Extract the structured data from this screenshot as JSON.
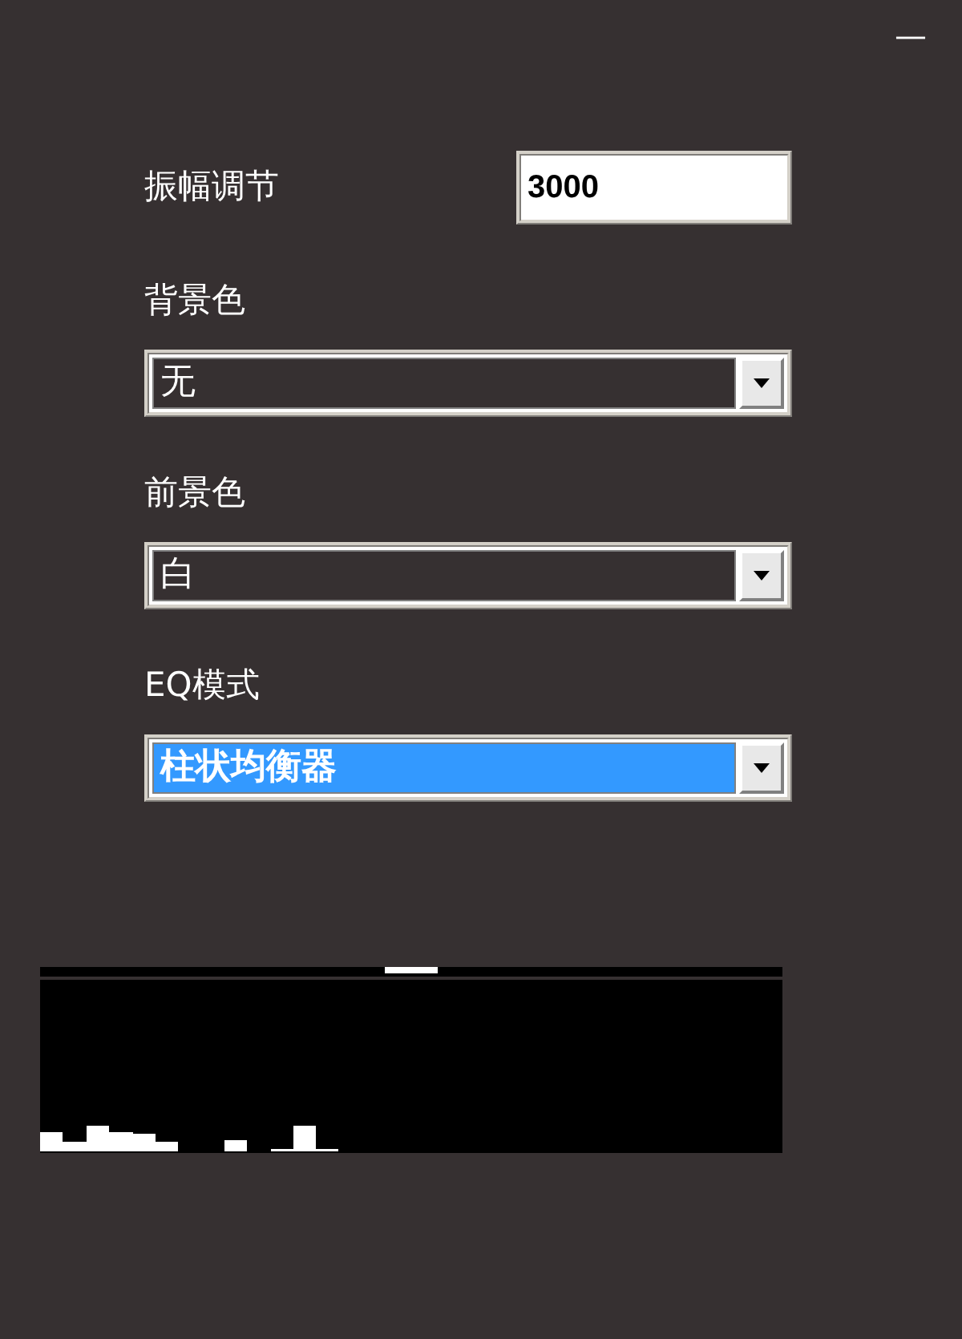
{
  "minimize_button": "—",
  "amplitude": {
    "label": "振幅调节",
    "value": "3000"
  },
  "dropdowns": [
    {
      "label": "背景色",
      "value": "无",
      "highlighted": false
    },
    {
      "label": "前景色",
      "value": "白",
      "highlighted": false
    },
    {
      "label": "EQ模式",
      "value": "柱状均衡器",
      "highlighted": true
    }
  ]
}
